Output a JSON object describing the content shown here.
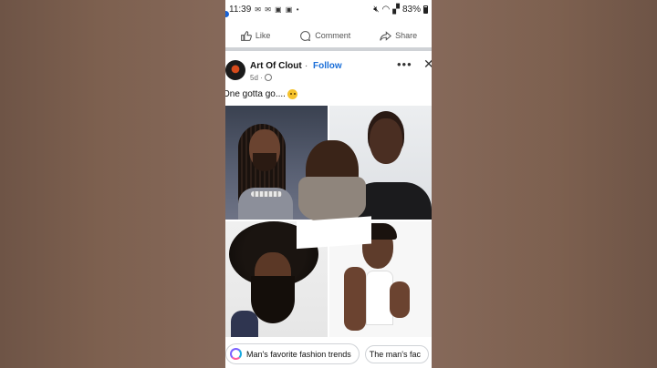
{
  "status_bar": {
    "time": "11:39",
    "notifications": "✉ ✉ ▣ ▣ •",
    "battery": "83%"
  },
  "actions": {
    "like": "Like",
    "comment": "Comment",
    "share": "Share"
  },
  "post": {
    "author": "Art Of Clout",
    "separator": "·",
    "follow": "Follow",
    "time": "5d ·",
    "caption": "One gotta go...."
  },
  "suggestions": [
    {
      "label": "Man's favorite fashion trends"
    },
    {
      "label": "The man's fac"
    }
  ],
  "colors": {
    "background": "#86695a",
    "follow_blue": "#1a6ed8"
  }
}
